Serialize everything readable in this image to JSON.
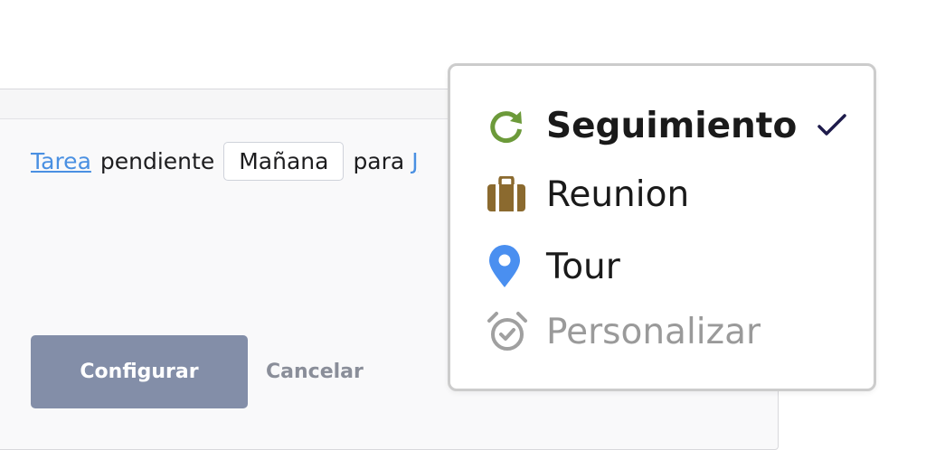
{
  "form": {
    "sentence": {
      "type_link": "Tarea",
      "word_pending": "pendiente",
      "date_value": "Mañana",
      "word_for": "para",
      "assignee_link": "J"
    },
    "submit_label": "Configurar",
    "cancel_label": "Cancelar"
  },
  "dropdown": {
    "options": [
      {
        "label": "Seguimiento",
        "icon": "refresh-arrow-icon",
        "icon_color": "#6c9a3a",
        "selected": true
      },
      {
        "label": "Reunion",
        "icon": "briefcase-icon",
        "icon_color": "#8b6a2f",
        "selected": false
      },
      {
        "label": "Tour",
        "icon": "map-pin-icon",
        "icon_color": "#4a8ff0",
        "selected": false
      },
      {
        "label": "Personalizar",
        "icon": "alarm-clock-icon",
        "icon_color": "#a0a0a0",
        "selected": false
      }
    ],
    "check_color": "#1e1b4b"
  },
  "colors": {
    "link": "#4a90e2",
    "primary_button": "#838ea8"
  }
}
